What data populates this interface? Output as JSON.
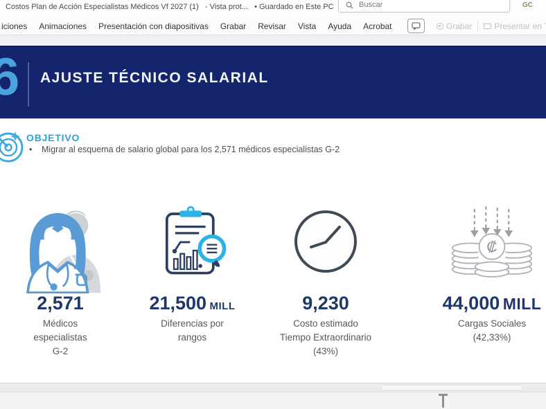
{
  "titlebar": {
    "document_title": "Costos Plan de Acción Especialistas Médicos Vf 2027 (1)",
    "mode_text": "-  Vista prot...",
    "saved_text": "•  Guardado en Este PC",
    "search_placeholder": "Buscar",
    "user_initials": "GC"
  },
  "ribbon": {
    "tabs": [
      "iciones",
      "Animaciones",
      "Presentación con diapositivas",
      "Grabar",
      "Revisar",
      "Vista",
      "Ayuda",
      "Acrobat"
    ],
    "record_label": "Grabar",
    "present_label": "Presentar en Tea"
  },
  "slide": {
    "number": "6",
    "title": "AJUSTE TÉCNICO SALARIAL",
    "objective": {
      "heading": "OBJETIVO",
      "bullet": "•",
      "text": "Migrar al esquema de salario global para los 2,571 médicos especialistas G-2"
    },
    "stats": [
      {
        "icon": "doctors-icon",
        "value": "2,571",
        "suffix": "",
        "lines": [
          "Médicos",
          "especialistas",
          "G-2"
        ]
      },
      {
        "icon": "clipboard-chart-icon",
        "value": "21,500",
        "suffix": "MILL",
        "lines": [
          "Diferencias por",
          "rangos"
        ]
      },
      {
        "icon": "clock-icon",
        "value": "9,230",
        "suffix": "",
        "lines": [
          "Costo estimado",
          "Tiempo Extraordinario",
          "(43%)"
        ]
      },
      {
        "icon": "coins-colon-icon",
        "value": "44,000",
        "suffix": "MILL",
        "symbol": "₡",
        "lines": [
          "Cargas Sociales",
          "(42,33%)"
        ]
      }
    ]
  },
  "colors": {
    "band_navy": "#14256e",
    "slide_accent_blue": "#29a3dc",
    "stat_number_navy": "#1f3868",
    "label_gray": "#595959",
    "doctor_blue": "#5b9bd5",
    "icon_cyan": "#2bb3e6"
  }
}
